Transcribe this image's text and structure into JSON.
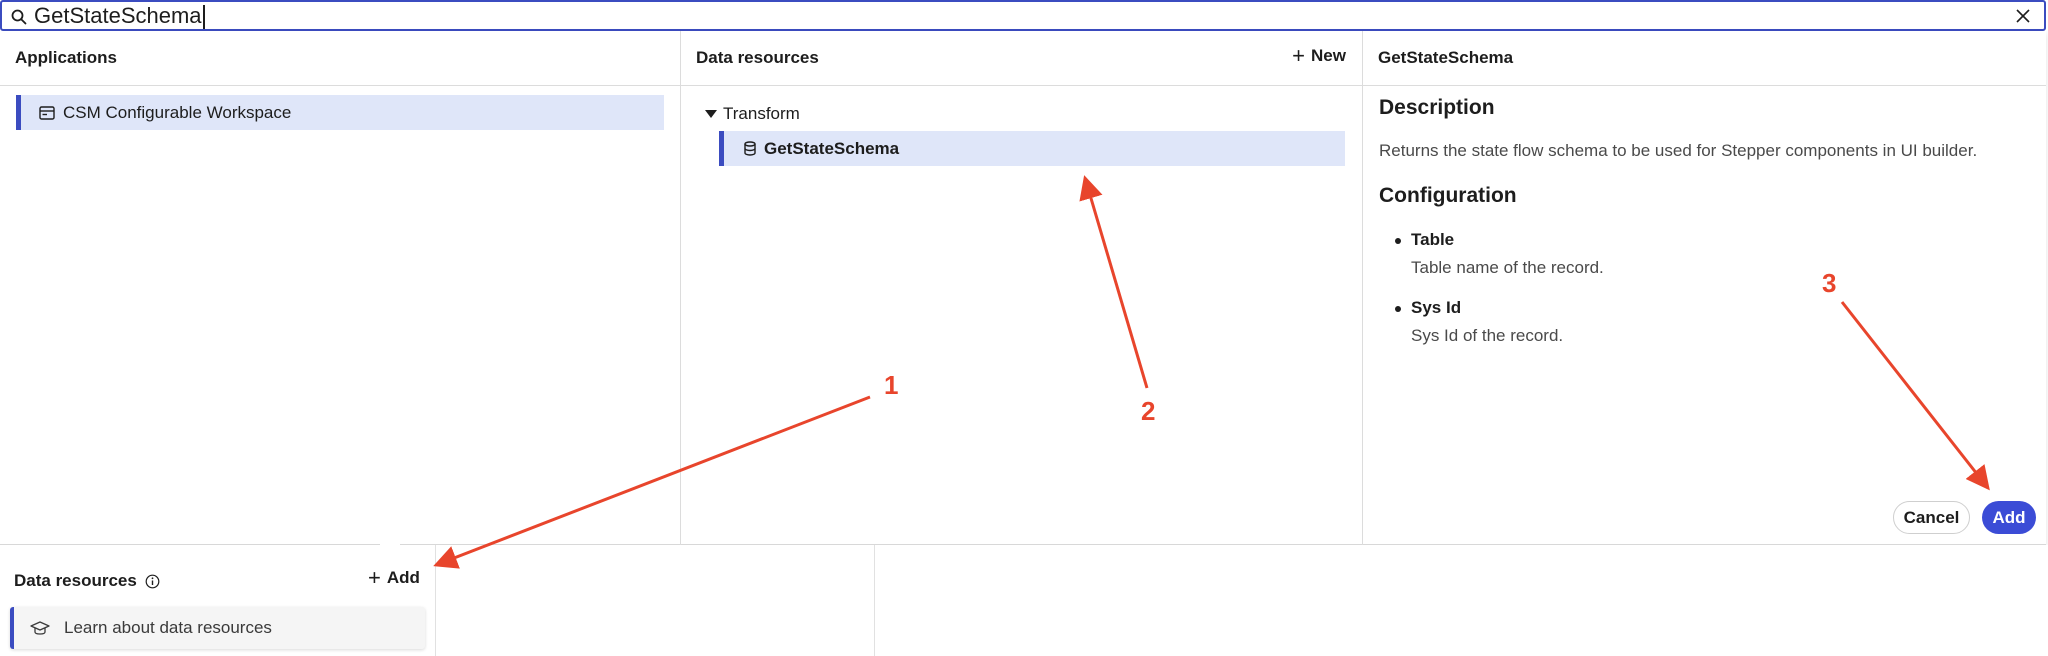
{
  "search": {
    "value": "GetStateSchema"
  },
  "applications": {
    "header": "Applications",
    "selected_item": "CSM Configurable Workspace"
  },
  "data_resources_panel": {
    "header": "Data resources",
    "new_label": "New",
    "tree_parent": "Transform",
    "tree_child": "GetStateSchema"
  },
  "detail": {
    "header": "GetStateSchema",
    "description_heading": "Description",
    "description_text": "Returns the state flow schema to be used for Stepper components in UI builder.",
    "configuration_heading": "Configuration",
    "config_items": [
      {
        "name": "Table",
        "desc": "Table name of the record."
      },
      {
        "name": "Sys Id",
        "desc": "Sys Id of the record."
      }
    ],
    "cancel_label": "Cancel",
    "add_label": "Add"
  },
  "bottom": {
    "title": "Data resources",
    "add_label": "Add",
    "learn_label": "Learn about data resources"
  },
  "annotations": {
    "n1": "1",
    "n2": "2",
    "n3": "3"
  },
  "colors": {
    "accent": "#3b4cc0",
    "selected_bg": "#dfe6f9",
    "annotation": "#e8452c",
    "primary_button": "#3b4cd6"
  }
}
